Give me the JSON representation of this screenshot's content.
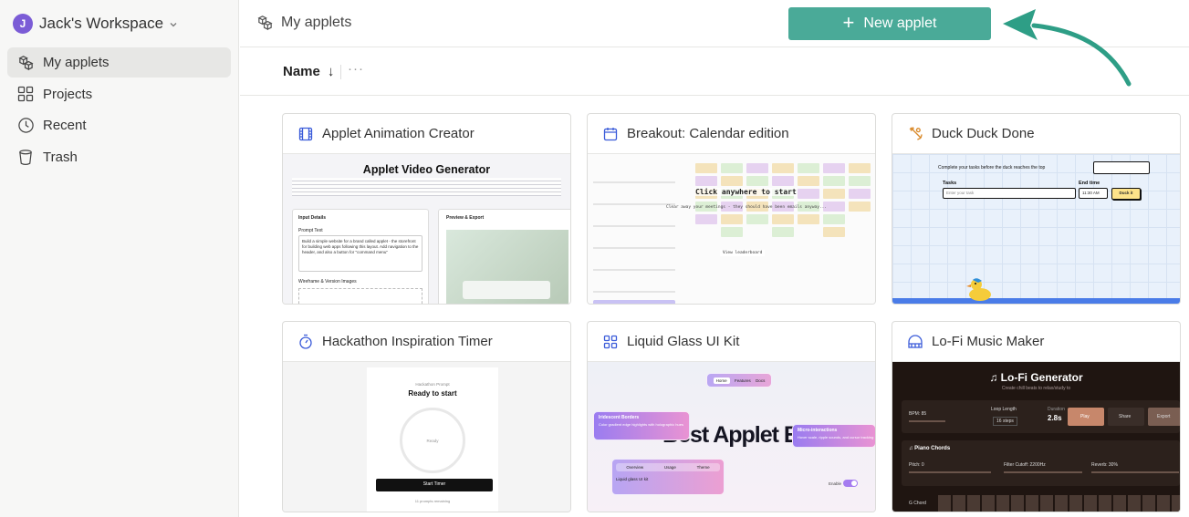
{
  "workspace": {
    "initial": "J",
    "name": "Jack's Workspace"
  },
  "sidebar": {
    "items": [
      {
        "label": "My applets",
        "icon": "applets-icon",
        "active": true
      },
      {
        "label": "Projects",
        "icon": "grid-icon",
        "active": false
      },
      {
        "label": "Recent",
        "icon": "clock-icon",
        "active": false
      },
      {
        "label": "Trash",
        "icon": "trash-icon",
        "active": false
      }
    ]
  },
  "header": {
    "title": "My applets",
    "new_button": "New applet"
  },
  "sortbar": {
    "label": "Name",
    "direction": "↓",
    "more": "···"
  },
  "colors": {
    "accent": "#4aaa98",
    "avatar": "#7b5cd6",
    "icon_blue": "#3a5bd9"
  },
  "cards": [
    {
      "title": "Applet Animation Creator",
      "icon": "film-icon",
      "preview": {
        "heading": "Applet Video Generator",
        "input_label": "Input Details",
        "prompt_label": "Prompt Text",
        "prompt_text": "Build a simple website for a brand called applet - the storefront for building web apps following this layout. Add navigation to the header, and also a button for \"command menu\"",
        "wireframe_label": "Wireframe & Version Images",
        "preview_label": "Preview & Export"
      }
    },
    {
      "title": "Breakout: Calendar edition",
      "icon": "calendar-icon",
      "preview": {
        "click_text": "Click anywhere to start",
        "hint_text": "Clear away your meetings - they should have been emails anyway...",
        "leaderboard": "View leaderboard"
      }
    },
    {
      "title": "Duck Duck Done",
      "icon": "duck-icon",
      "preview": {
        "intro": "Complete your tasks before the duck reaches the top",
        "tasks_label": "Tasks",
        "end_label": "End time",
        "time": "11:30 AM",
        "button": "Duck it",
        "placeholder": "Enter your task"
      }
    },
    {
      "title": "Hackathon Inspiration Timer",
      "icon": "stopwatch-icon",
      "preview": {
        "caption": "Hackathon Prompt",
        "heading": "Ready to start",
        "ring": "Ready",
        "button": "Start Timer",
        "footer": "11 prompts remaining"
      }
    },
    {
      "title": "Liquid Glass UI Kit",
      "icon": "grid-icon",
      "preview": {
        "big": "Best Applet Ev",
        "tabs": [
          "Home",
          "Features",
          "Docs"
        ],
        "card1_title": "Iridescent Borders",
        "card1_text": "Color gradient edge highlights with holographic hues",
        "card2_title": "Micro-interactions",
        "card2_text": "Hover scale, ripple sounds, and cursor tracking",
        "tabs2": [
          "Overview",
          "Usage",
          "Theme"
        ],
        "kit": "Liquid glass UI kit",
        "toggle": "Enable"
      }
    },
    {
      "title": "Lo-Fi Music Maker",
      "icon": "piano-icon",
      "preview": {
        "heading": "♫ Lo-Fi Generator",
        "sub": "Create chill beats to relax/study to",
        "bpm": "BPM: 85",
        "loop_label": "Loop Length",
        "loop_value": "16 steps",
        "duration_label": "Duration",
        "duration": "2.8s",
        "play": "Play",
        "share": "Share",
        "export": "Export",
        "chords": "♫ Piano Chords",
        "pitch": "Pitch: 0",
        "filter": "Filter Cutoff: 2200Hz",
        "reverb": "Reverb: 30%",
        "chord_label": "G Chord"
      }
    }
  ]
}
